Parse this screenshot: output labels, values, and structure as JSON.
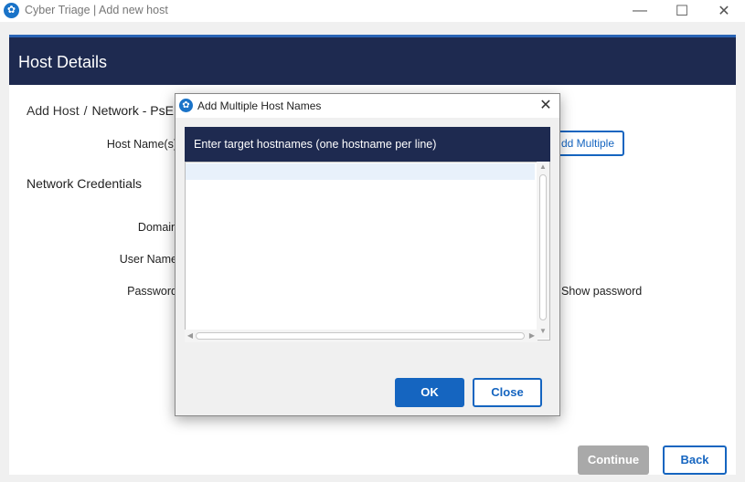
{
  "window": {
    "title": "Cyber Triage | Add new host",
    "minimize": "—",
    "maximize": "☐",
    "close": "✕"
  },
  "header": {
    "title": "Host Details"
  },
  "breadcrumb": {
    "part1": "Add Host",
    "separator": "/",
    "part2": "Network - PsE"
  },
  "form": {
    "hostname_label": "Host Name(s)",
    "add_multiple_label": "dd Multiple",
    "section_title": "Network Credentials",
    "domain_label": "Domain",
    "user_label": "User Name",
    "password_label": "Password",
    "show_password_label": "Show password"
  },
  "footer": {
    "continue_label": "Continue",
    "back_label": "Back"
  },
  "dialog": {
    "title": "Add Multiple Host Names",
    "close_glyph": "✕",
    "instruction": "Enter target hostnames (one hostname per line)",
    "textarea_value": "",
    "ok_label": "OK",
    "close_label": "Close"
  },
  "icons": {
    "app": "cyber-triage-logo-icon",
    "scroll_up": "▲",
    "scroll_down": "▼",
    "scroll_left": "◀",
    "scroll_right": "▶"
  },
  "colors": {
    "header_bg": "#1e2a50",
    "accent": "#1565c0",
    "disabled": "#a9a9a9"
  }
}
